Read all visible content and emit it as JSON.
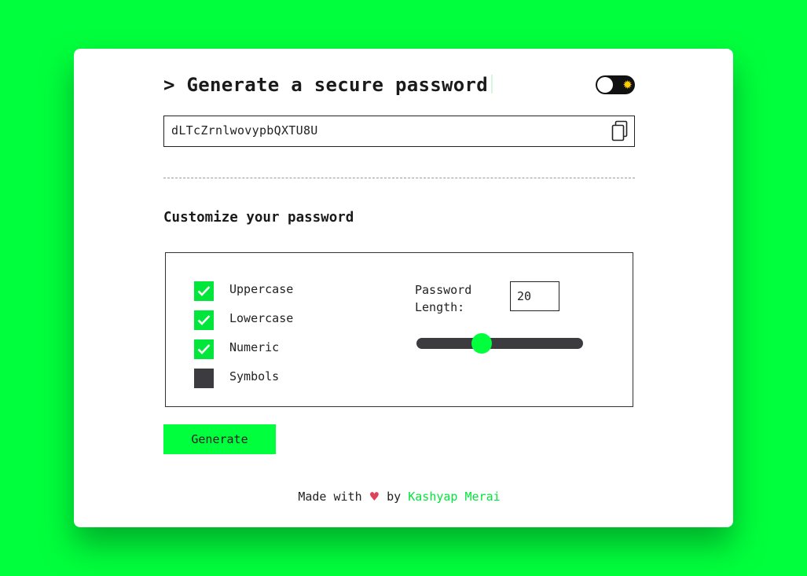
{
  "header": {
    "title": "> Generate a secure password",
    "theme_toggle": {
      "state": "light",
      "icon": "sun-icon"
    }
  },
  "password": {
    "value": "dLTcZrnlwovypbQXTU8U",
    "copy_icon": "copy-icon"
  },
  "customize": {
    "title": "Customize your password",
    "options": [
      {
        "label": "Uppercase",
        "checked": true
      },
      {
        "label": "Lowercase",
        "checked": true
      },
      {
        "label": "Numeric",
        "checked": true
      },
      {
        "label": "Symbols",
        "checked": false
      }
    ],
    "length_label": "Password Length:",
    "length_value": "20",
    "slider_fraction": 0.39
  },
  "actions": {
    "generate_label": "Generate"
  },
  "footer": {
    "prefix": "Made with",
    "heart": "♥",
    "by": "by",
    "author": "Kashyap Merai"
  },
  "colors": {
    "background": "#00ff3c",
    "accent": "#00e63a",
    "dark": "#3c3b40",
    "heart": "#e0415a"
  }
}
